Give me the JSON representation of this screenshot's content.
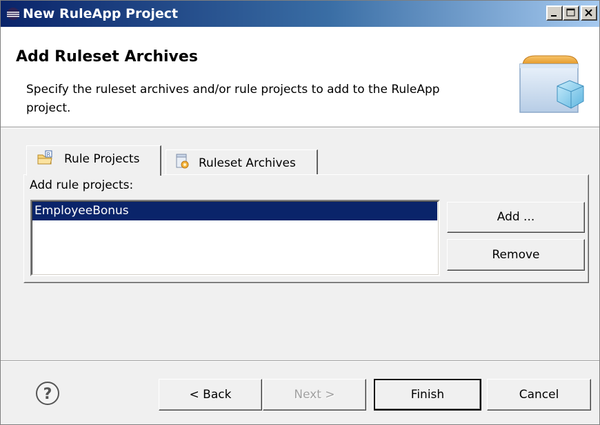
{
  "window": {
    "title": "New RuleApp Project"
  },
  "header": {
    "page_title": "Add Ruleset Archives",
    "description": "Specify the ruleset archives and/or rule projects to add to the RuleApp project."
  },
  "tabs": [
    {
      "label": "Rule Projects",
      "icon": "rule-project-folder-icon",
      "selected": true
    },
    {
      "label": "Ruleset Archives",
      "icon": "ruleset-archive-icon",
      "selected": false
    }
  ],
  "rule_projects_panel": {
    "label": "Add rule projects:",
    "items": [
      "EmployeeBonus"
    ],
    "selected_index": 0,
    "add_label": "Add ...",
    "remove_label": "Remove"
  },
  "footer": {
    "back_label": "< Back",
    "next_label": "Next >",
    "finish_label": "Finish",
    "cancel_label": "Cancel",
    "next_enabled": false
  },
  "colors": {
    "titlebar_start": "#0a246a",
    "titlebar_end": "#a6caf0",
    "selection": "#0a246a"
  }
}
